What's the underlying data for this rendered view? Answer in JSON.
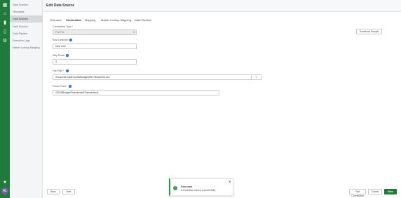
{
  "rail": {
    "icons": [
      "grid-icon",
      "home-icon",
      "book-icon",
      "document-icon",
      "gear-icon",
      "bell-icon"
    ],
    "avatar_initials": "AL"
  },
  "sidebar": {
    "items": [
      {
        "label": "Data Sources"
      },
      {
        "label": "Templates"
      },
      {
        "label": "Data Sources"
      },
      {
        "label": "Data Sources"
      },
      {
        "label": "Data Pipeline"
      },
      {
        "label": "Execution Logs"
      },
      {
        "label": "Master Lookup Mapping"
      }
    ]
  },
  "header": {
    "title": "Edit Data Source"
  },
  "tabs": [
    "Overview",
    "Connection",
    "Mapping",
    "Master Lookup Mapping",
    "Data Pipeline"
  ],
  "active_tab": "Connection",
  "download_sample_label": "Download Sample",
  "form": {
    "connection_type": {
      "label": "Connection Type *",
      "value": "Flat File"
    },
    "row_delimiter": {
      "label": "Row Delimiter",
      "value": "New Line"
    },
    "skip_rows": {
      "label": "Skip Rows",
      "value": "3"
    },
    "file_path": {
      "label": "File Path *",
      "value": "/Financial Statements/Budget/Ref Files/2024.csv",
      "browse_icon": "search-icon"
    },
    "folder_path": {
      "label": "Folder Path *",
      "value": "/2024/Budget/Dashboard/Transactions"
    }
  },
  "toast": {
    "title": "Success",
    "message": "Connection saved successfully",
    "status_color": "#2a9a47"
  },
  "footer": {
    "back_label": "Back",
    "next_label": "Next",
    "test_label": "Test Connection",
    "cancel_label": "Cancel",
    "save_label": "Save"
  },
  "colors": {
    "brand": "#1f7a3c",
    "info": "#1b6ec2"
  }
}
